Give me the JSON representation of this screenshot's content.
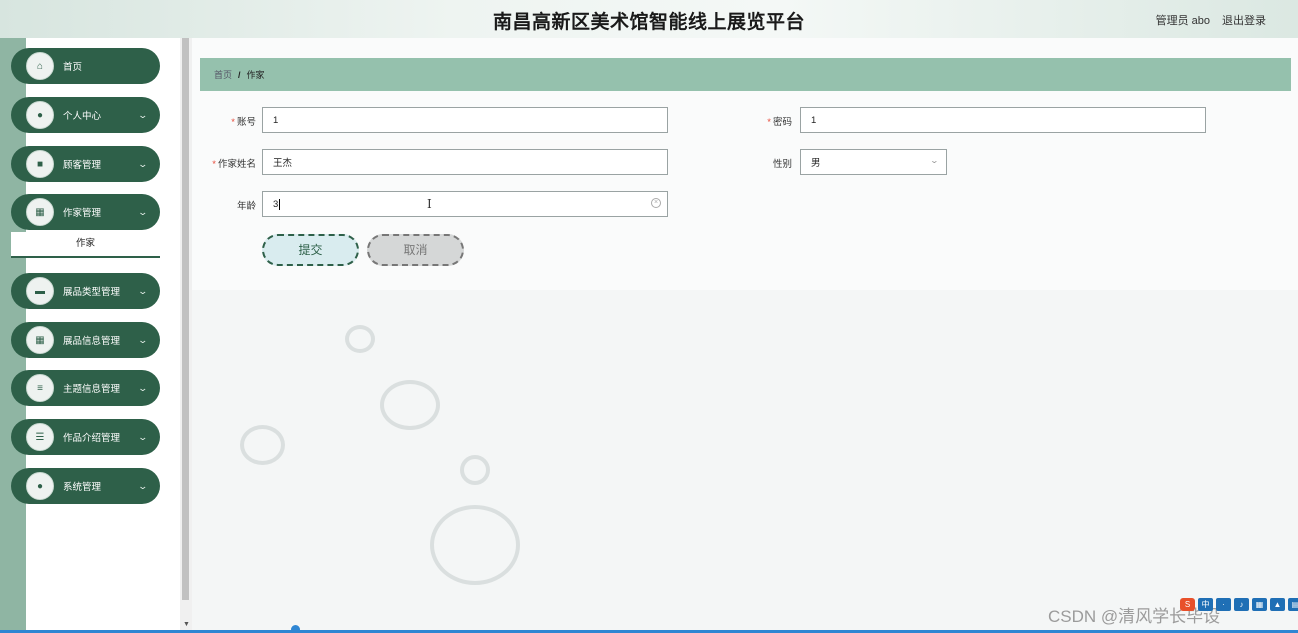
{
  "header": {
    "title": "南昌高新区美术馆智能线上展览平台",
    "user_label": "管理员 abo",
    "logout_label": "退出登录"
  },
  "sidebar": {
    "items": [
      {
        "label": "首页",
        "icon": "home-icon",
        "glyph": "⌂",
        "has_chevron": false
      },
      {
        "label": "个人中心",
        "icon": "person-icon",
        "glyph": "●",
        "has_chevron": true
      },
      {
        "label": "顾客管理",
        "icon": "monitor-icon",
        "glyph": "■",
        "has_chevron": true
      },
      {
        "label": "作家管理",
        "icon": "grid-icon",
        "glyph": "▦",
        "has_chevron": true
      },
      {
        "label": "展品类型管理",
        "icon": "briefcase-icon",
        "glyph": "▬",
        "has_chevron": true
      },
      {
        "label": "展品信息管理",
        "icon": "grid-icon",
        "glyph": "▦",
        "has_chevron": true
      },
      {
        "label": "主题信息管理",
        "icon": "sliders-icon",
        "glyph": "≡",
        "has_chevron": true
      },
      {
        "label": "作品介绍管理",
        "icon": "list-icon",
        "glyph": "☰",
        "has_chevron": true
      },
      {
        "label": "系统管理",
        "icon": "person-icon",
        "glyph": "●",
        "has_chevron": true
      }
    ],
    "submenu_label": "作家",
    "chevron": "⌄"
  },
  "breadcrumb": {
    "home": "首页",
    "separator": "/",
    "current": "作家"
  },
  "form": {
    "account_label": "账号",
    "account_value": "1",
    "password_label": "密码",
    "password_value": "1",
    "name_label": "作家姓名",
    "name_value": "王杰",
    "gender_label": "性别",
    "gender_value": "男",
    "age_label": "年龄",
    "age_value": "3",
    "required_mark": "*",
    "submit_label": "提交",
    "cancel_label": "取消"
  },
  "watermark": "CSDN @清风学长毕设"
}
